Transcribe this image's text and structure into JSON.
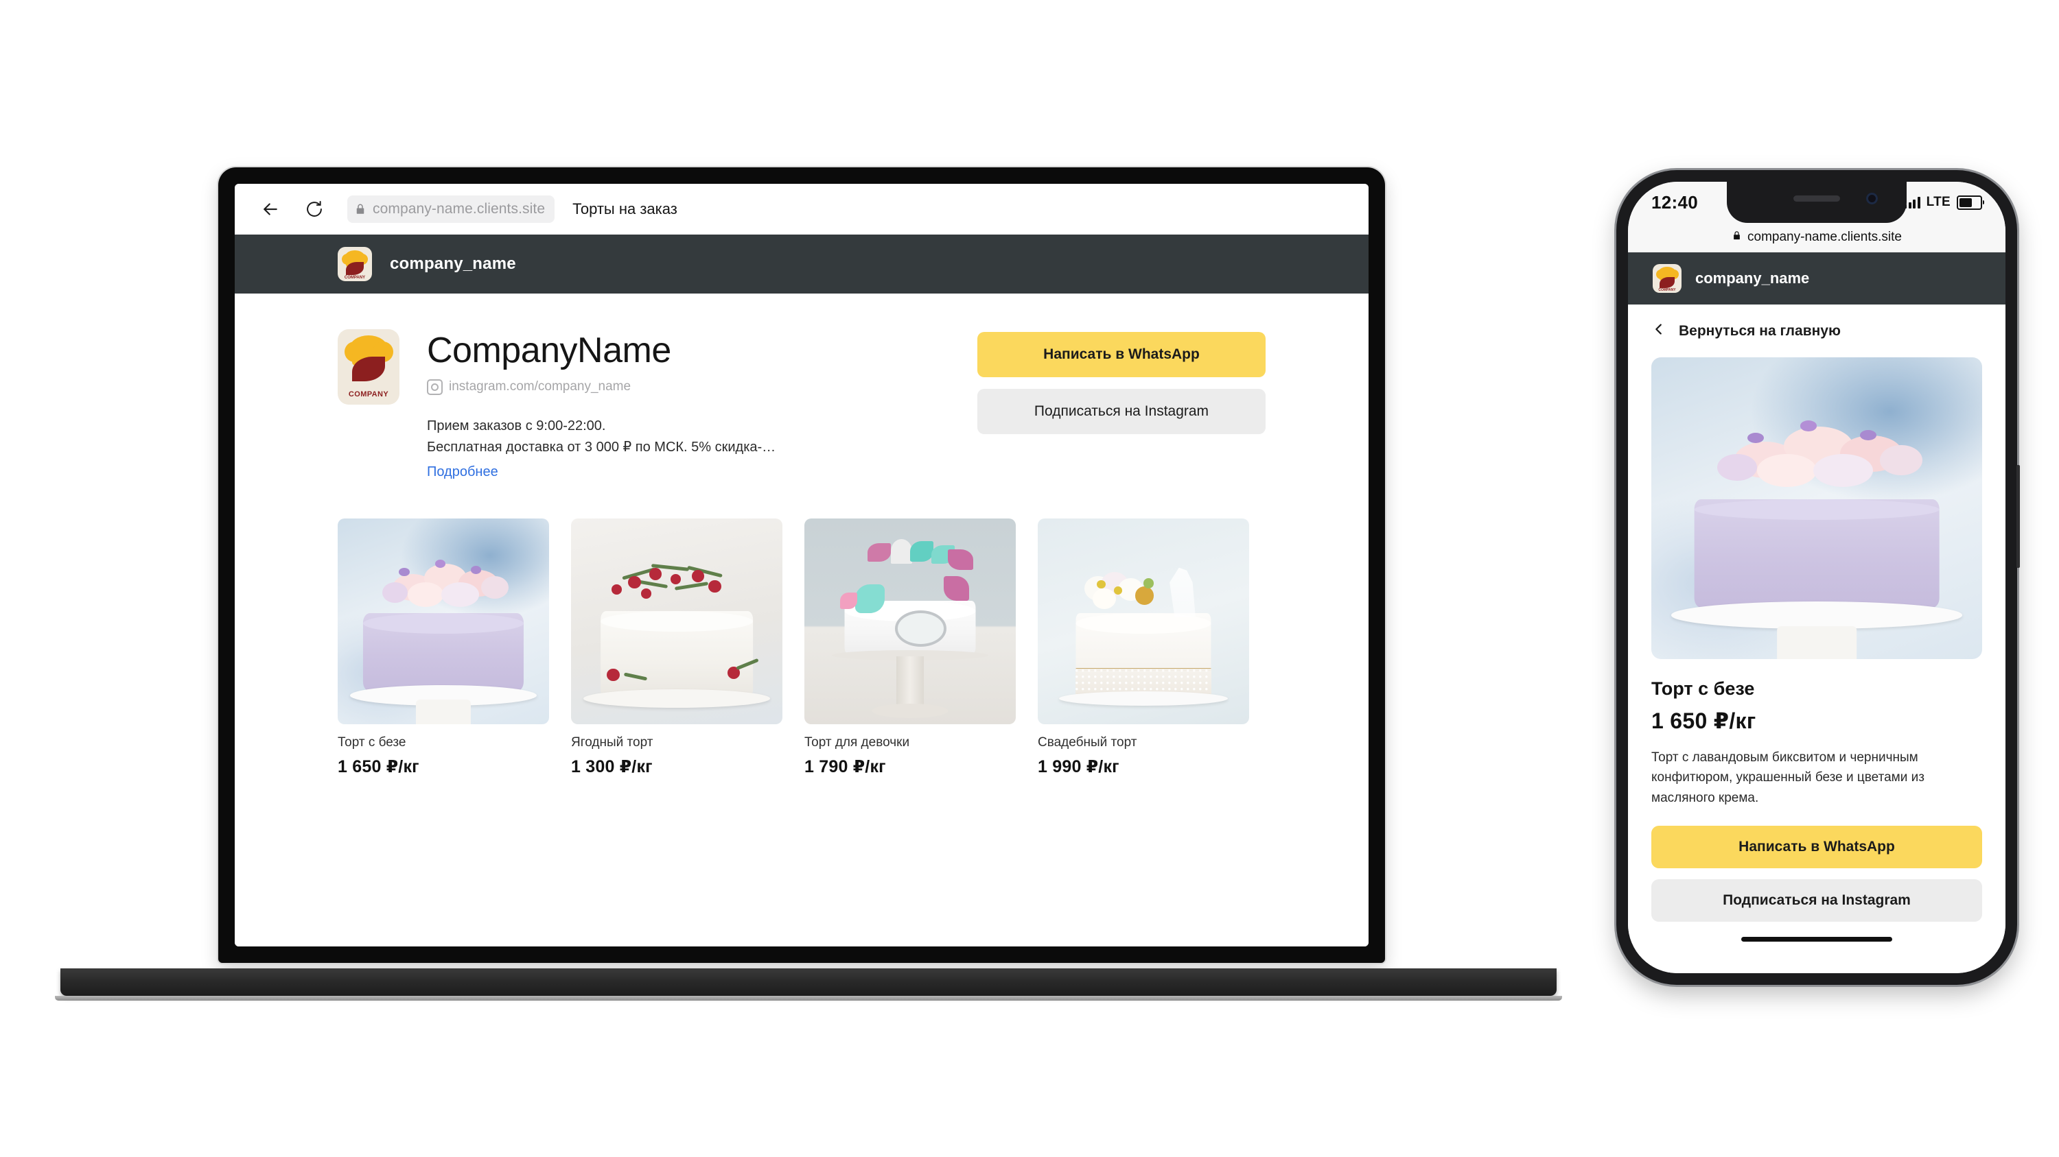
{
  "laptop": {
    "browser": {
      "back_icon": "back-arrow-icon",
      "reload_icon": "reload-icon",
      "lock_icon": "lock-icon",
      "url": "company-name.clients.site",
      "tab_title": "Торты на заказ"
    },
    "site_header": {
      "logo_word": "COMPANY",
      "brand": "company_name"
    },
    "hero": {
      "company_title": "CompanyName",
      "instagram_icon": "instagram-icon",
      "instagram_link": "instagram.com/company_name",
      "description_line1": "Прием заказов с 9:00-22:00.",
      "description_line2": "Бесплатная доставка от 3 000 ₽ по МСК. 5% скидка-…",
      "more_link": "Подробнее",
      "whatsapp_button": "Написать в WhatsApp",
      "instagram_button": "Подписаться на Instagram"
    },
    "products": [
      {
        "name": "Торт с безе",
        "price": "1 650 ₽/кг",
        "image": "lavender-cake-with-flowers"
      },
      {
        "name": "Ягодный торт",
        "price": "1 300 ₽/кг",
        "image": "white-cake-with-cranberries"
      },
      {
        "name": "Торт для девочки",
        "price": "1 790 ₽/кг",
        "image": "white-cake-with-butterflies"
      },
      {
        "name": "Свадебный торт",
        "price": "1 990 ₽/кг",
        "image": "wedding-cake-with-topper"
      }
    ]
  },
  "phone": {
    "status_bar": {
      "time": "12:40",
      "signal_icon": "signal-bars-icon",
      "network": "LTE",
      "battery_icon": "battery-icon"
    },
    "url_bar": {
      "lock_icon": "lock-icon",
      "url": "company-name.clients.site"
    },
    "site_header": {
      "logo_word": "COMPANY",
      "brand": "company_name"
    },
    "back": {
      "icon": "chevron-left-icon",
      "label": "Вернуться на главную"
    },
    "product": {
      "image": "lavender-cake-with-flowers",
      "title": "Торт с безе",
      "price": "1 650 ₽/кг",
      "description": "Торт с лавандовым биксвитом и черничным конфитюром, украшенный безе и цветами из масляного крема.",
      "whatsapp_button": "Написать в WhatsApp",
      "instagram_button": "Подписаться на Instagram"
    }
  },
  "colors": {
    "accent_yellow": "#fbd85d",
    "header_dark": "#343a3d",
    "secondary_gray": "#ececec",
    "link_blue": "#2f6fe0",
    "logo_gold": "#f5b722",
    "logo_maroon": "#8c1f1f"
  }
}
